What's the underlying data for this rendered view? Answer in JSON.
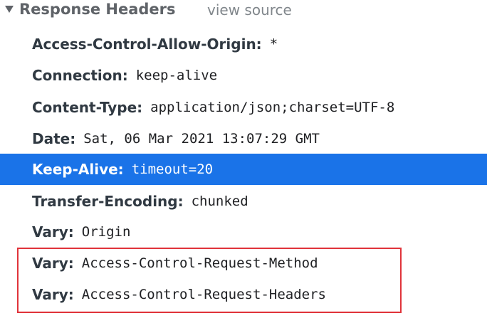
{
  "section": {
    "title": "Response Headers",
    "view_source": "view source",
    "expanded": true
  },
  "headers": [
    {
      "name": "Access-Control-Allow-Origin:",
      "value": "*"
    },
    {
      "name": "Connection:",
      "value": "keep-alive"
    },
    {
      "name": "Content-Type:",
      "value": "application/json;charset=UTF-8"
    },
    {
      "name": "Date:",
      "value": "Sat, 06 Mar 2021 13:07:29 GMT"
    },
    {
      "name": "Keep-Alive:",
      "value": "timeout=20"
    },
    {
      "name": "Transfer-Encoding:",
      "value": "chunked"
    },
    {
      "name": "Vary:",
      "value": "Origin"
    },
    {
      "name": "Vary:",
      "value": "Access-Control-Request-Method"
    },
    {
      "name": "Vary:",
      "value": "Access-Control-Request-Headers"
    }
  ],
  "selected_header": "Keep-Alive:",
  "colors": {
    "selection": "#1a73e8",
    "highlight_border": "#e0333a",
    "header_name": "#303942",
    "section_title": "#5f6368"
  }
}
